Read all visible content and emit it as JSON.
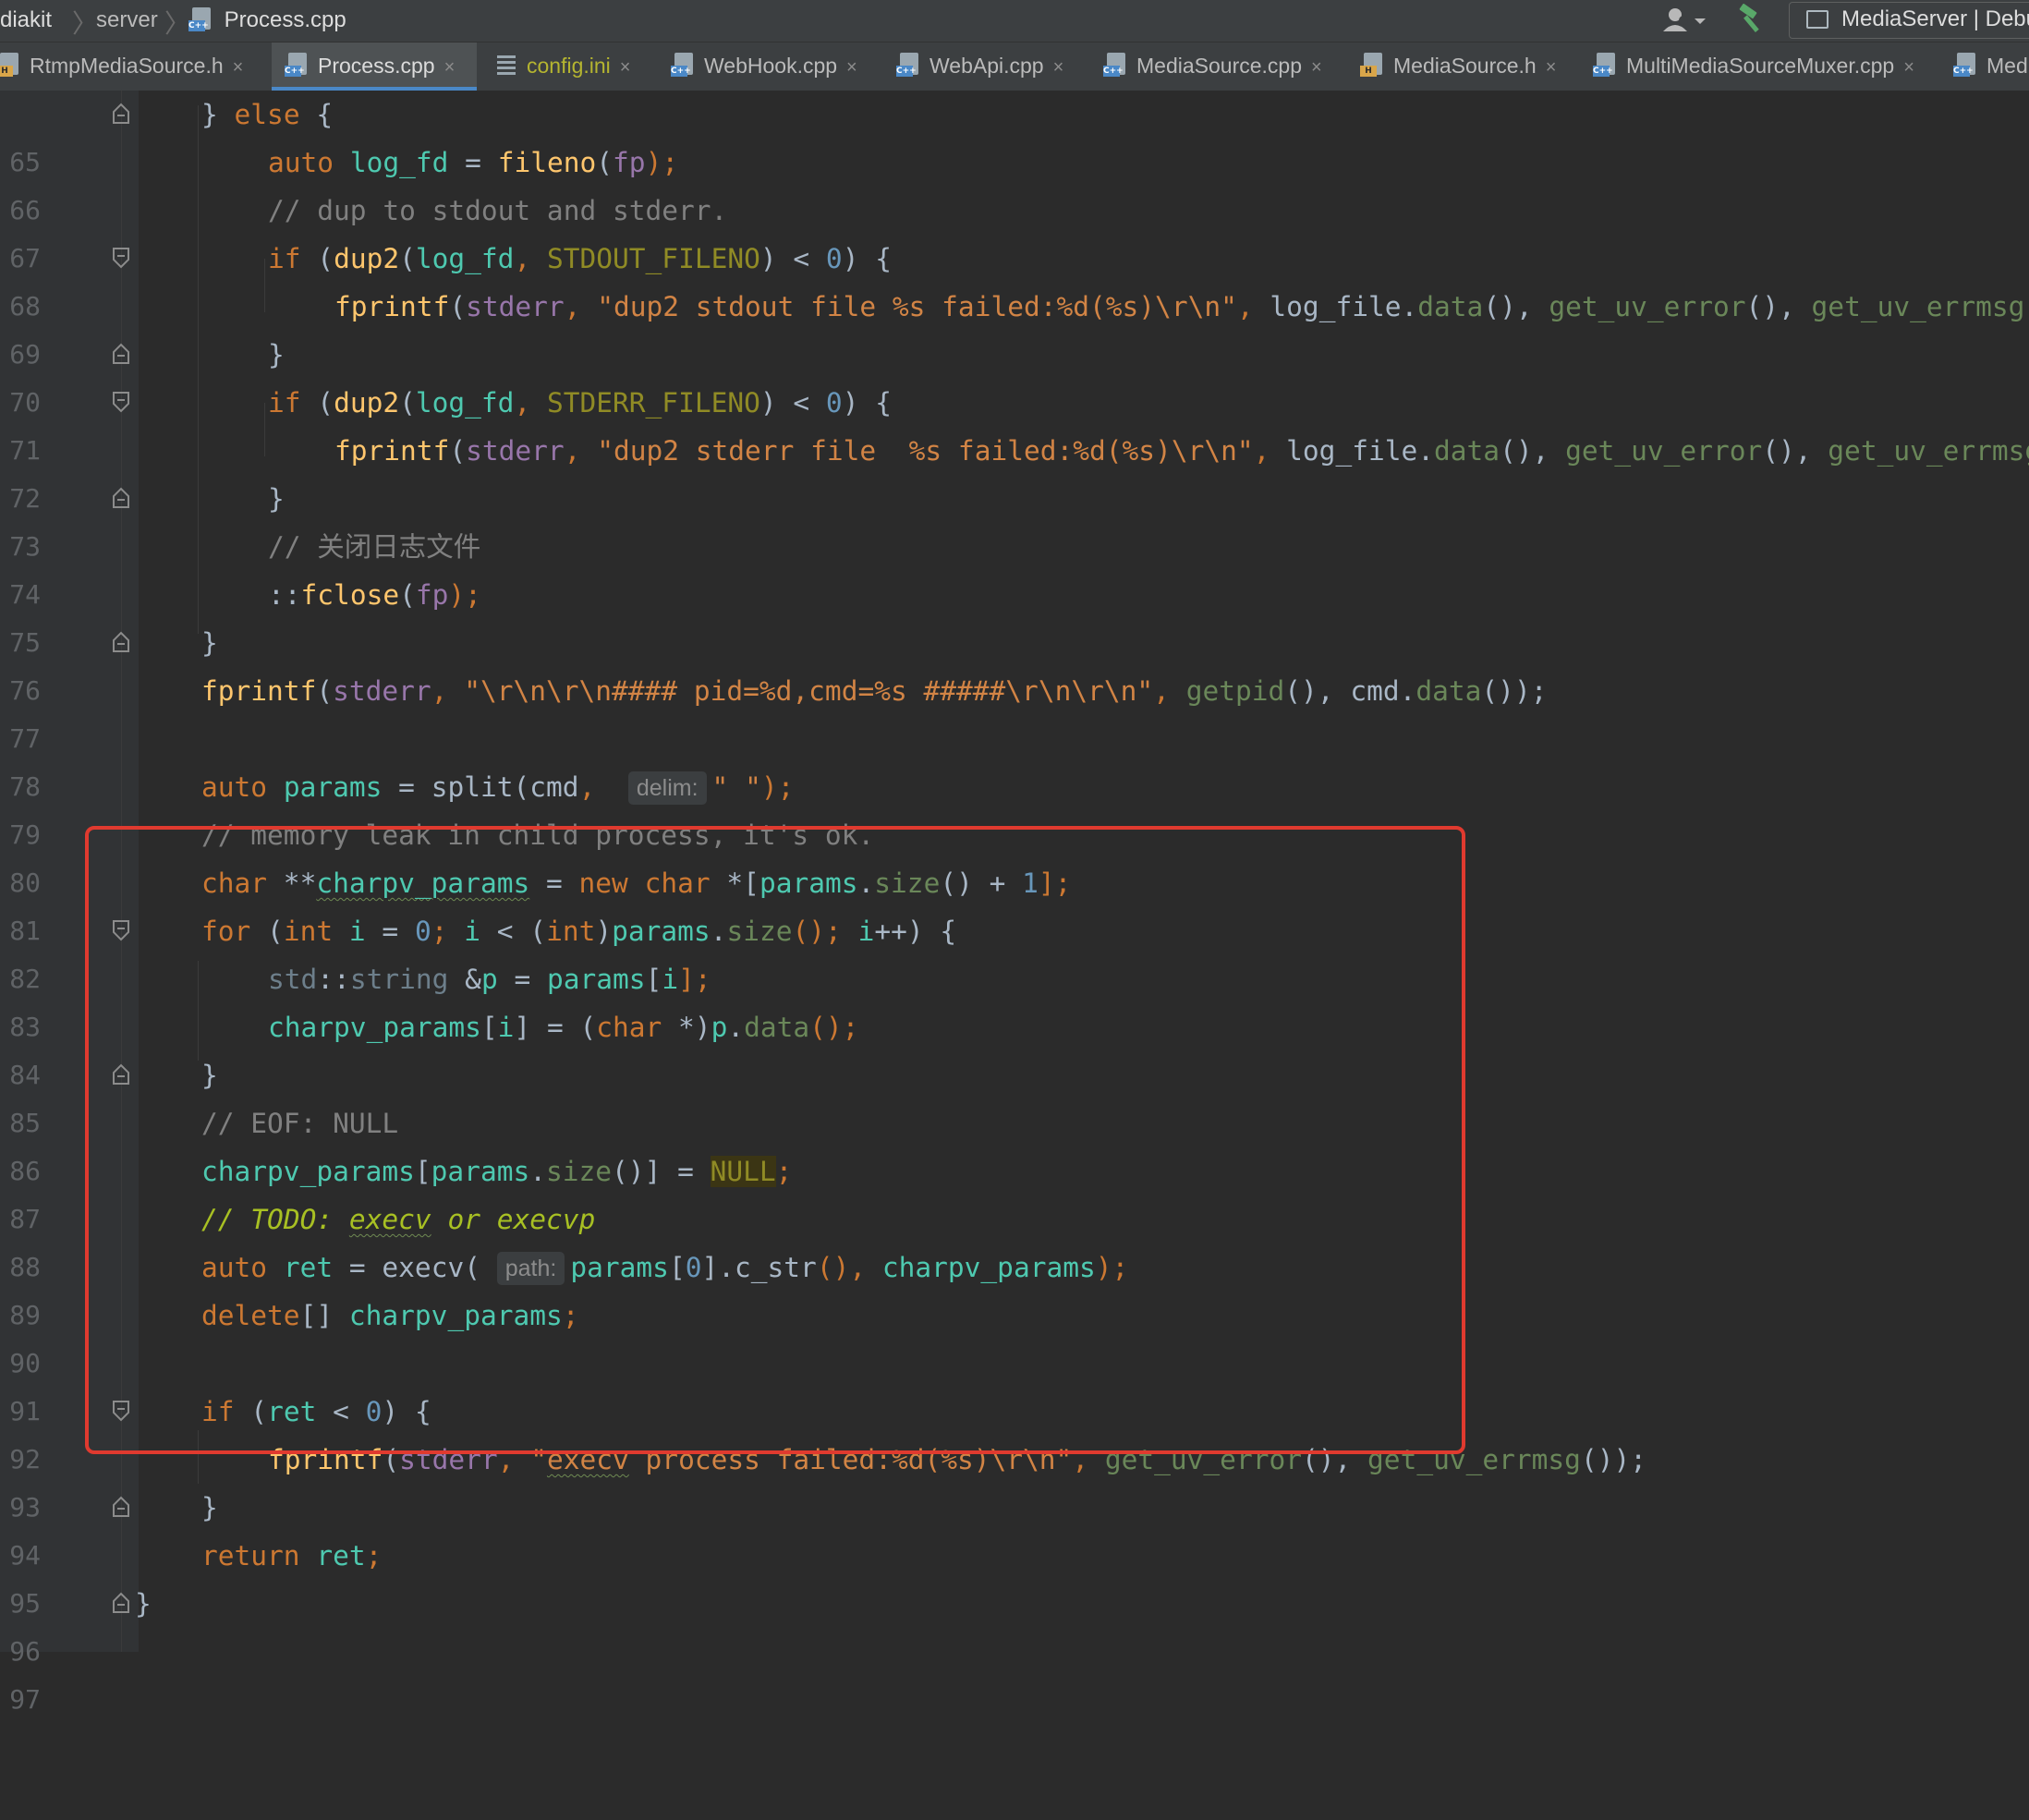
{
  "breadcrumb": {
    "items": [
      "diakit",
      "server",
      "Process.cpp"
    ]
  },
  "run_config": {
    "label": "MediaServer | Debug"
  },
  "tabs": [
    {
      "label": "RtmpMediaSource.h",
      "type": "h",
      "active": false
    },
    {
      "label": "Process.cpp",
      "type": "cpp",
      "active": true
    },
    {
      "label": "config.ini",
      "type": "ini",
      "active": false
    },
    {
      "label": "WebHook.cpp",
      "type": "cpp",
      "active": false
    },
    {
      "label": "WebApi.cpp",
      "type": "cpp",
      "active": false
    },
    {
      "label": "MediaSource.cpp",
      "type": "cpp",
      "active": false
    },
    {
      "label": "MediaSource.h",
      "type": "h",
      "active": false
    },
    {
      "label": "MultiMediaSourceMuxer.cpp",
      "type": "cpp",
      "active": false
    },
    {
      "label": "Med",
      "type": "cpp",
      "active": false
    }
  ],
  "icons": {
    "cpp_tag": "C++",
    "h_tag": "H",
    "close": "×"
  },
  "colors": {
    "highlight_box": "#e03a2f",
    "active_tab_indicator": "#4a88c7",
    "keyword": "#cc7832",
    "string": "#6a8759",
    "comment": "#808080"
  },
  "editor": {
    "line_numbers": [
      "65",
      "66",
      "67",
      "68",
      "69",
      "70",
      "71",
      "72",
      "73",
      "74",
      "75",
      "76",
      "77",
      "78",
      "79",
      "80",
      "81",
      "82",
      "83",
      "84",
      "85",
      "86",
      "87",
      "88",
      "89",
      "90",
      "91",
      "92",
      "93",
      "94",
      "95",
      "96",
      "97"
    ],
    "hints": {
      "delim": "delim:",
      "path": "path:"
    },
    "code": {
      "l65_close": "} ",
      "l65_else": "else",
      "l65_rest": " {",
      "l66_auto": "auto",
      "l66_var": "log_fd",
      "l66_eq": " = ",
      "l66_fn": "fileno",
      "l66_p1": "(",
      "l66_arg": "fp",
      "l66_p2": ");",
      "l67": "// dup to stdout and stderr.",
      "l68_if": "if",
      "l68_a": " (",
      "l68_fn": "dup2",
      "l68_b": "(",
      "l68_v": "log_fd",
      "l68_c": ", ",
      "l68_mac": "STDOUT_FILENO",
      "l68_d": ") < ",
      "l68_num": "0",
      "l68_e": ") {",
      "l69_fn": "fprintf",
      "l69_a": "(",
      "l69_v": "stderr",
      "l69_b": ", ",
      "l69_str": "\"dup2 stdout file %s failed:%d(%s)\\r\\n\"",
      "l69_c": ", ",
      "l69_d": "log_file",
      "l69_e": ".",
      "l69_f": "data",
      "l69_g": "(), ",
      "l69_h": "get_uv_error",
      "l69_i": "(), ",
      "l69_j": "get_uv_errmsg",
      "l70": "}",
      "l71_if": "if",
      "l71_a": " (",
      "l71_fn": "dup2",
      "l71_b": "(",
      "l71_v": "log_fd",
      "l71_c": ", ",
      "l71_mac": "STDERR_FILENO",
      "l71_d": ") < ",
      "l71_num": "0",
      "l71_e": ") {",
      "l72_fn": "fprintf",
      "l72_a": "(",
      "l72_v": "stderr",
      "l72_b": ", ",
      "l72_str": "\"dup2 stderr file  %s failed:%d(%s)\\r\\n\"",
      "l72_c": ", ",
      "l72_d": "log_file",
      "l72_e": ".",
      "l72_f": "data",
      "l72_g": "(), ",
      "l72_h": "get_uv_error",
      "l72_i": "(), ",
      "l72_j": "get_uv_errmsg",
      "l73": "}",
      "l74": "// 关闭日志文件",
      "l75_a": "::",
      "l75_fn": "fclose",
      "l75_b": "(",
      "l75_v": "fp",
      "l75_c": ");",
      "l76": "}",
      "l77_fn": "fprintf",
      "l77_a": "(",
      "l77_v": "stderr",
      "l77_b": ", ",
      "l77_str": "\"\\r\\n\\r\\n#### pid=%d,cmd=%s #####\\r\\n\\r\\n\"",
      "l77_c": ", ",
      "l77_d": "getpid",
      "l77_e": "(), ",
      "l77_f": "cmd",
      "l77_g": ".",
      "l77_h": "data",
      "l77_i": "());",
      "l79_auto": "auto",
      "l79_var": "params",
      "l79_eq": " = ",
      "l79_fn": "split",
      "l79_a": "(",
      "l79_b": "cmd",
      "l79_c": ", ",
      "l79_str": "\" \"",
      "l79_d": ");",
      "l80": "// memory leak in child process, it's ok.",
      "l81_kw": "char",
      "l81_a": " **",
      "l81_var": "charpv_params",
      "l81_b": " = ",
      "l81_new": "new",
      "l81_c": " ",
      "l81_char": "char",
      "l81_d": " *[",
      "l81_e": "params",
      "l81_f": ".",
      "l81_g": "size",
      "l81_h": "() + ",
      "l81_num": "1",
      "l81_i": "];",
      "l82_for": "for",
      "l82_a": " (",
      "l82_int": "int",
      "l82_b": " ",
      "l82_i": "i",
      "l82_c": " = ",
      "l82_num": "0",
      "l82_d": "; ",
      "l82_i2": "i",
      "l82_e": " < (",
      "l82_int2": "int",
      "l82_f": ")",
      "l82_g": "params",
      "l82_h": ".",
      "l82_j": "size",
      "l82_k": "(); ",
      "l82_i3": "i",
      "l82_l": "++) {",
      "l83_ns": "std",
      "l83_a": "::",
      "l83_t": "string",
      "l83_b": " &",
      "l83_p": "p",
      "l83_c": " = ",
      "l83_d": "params",
      "l83_e": "[",
      "l83_i": "i",
      "l83_f": "];",
      "l84_v": "charpv_params",
      "l84_a": "[",
      "l84_i": "i",
      "l84_b": "] = (",
      "l84_char": "char",
      "l84_c": " *)",
      "l84_p": "p",
      "l84_d": ".",
      "l84_fn": "data",
      "l84_e": "();",
      "l85": "}",
      "l86": "// EOF: NULL",
      "l87_v": "charpv_params",
      "l87_a": "[",
      "l87_b": "params",
      "l87_c": ".",
      "l87_d": "size",
      "l87_e": "()] = ",
      "l87_null": "NULL",
      "l87_f": ";",
      "l88_a": "// ",
      "l88_todo": "TODO: ",
      "l88_b": "execv",
      "l88_c": " or ",
      "l88_d": "execvp",
      "l89_auto": "auto",
      "l89_var": "ret",
      "l89_eq": " = ",
      "l89_fn": "execv",
      "l89_a": "(",
      "l89_b": "params",
      "l89_c": "[",
      "l89_num": "0",
      "l89_d": "].",
      "l89_e": "c_str",
      "l89_f": "(), ",
      "l89_g": "charpv_params",
      "l89_h": ");",
      "l90_kw": "delete",
      "l90_a": "[] ",
      "l90_v": "charpv_params",
      "l90_b": ";",
      "l92_if": "if",
      "l92_a": " (",
      "l92_v": "ret",
      "l92_b": " < ",
      "l92_num": "0",
      "l92_c": ") {",
      "l93_fn": "fprintf",
      "l93_a": "(",
      "l93_v": "stderr",
      "l93_b": ", ",
      "l93_s1": "\"",
      "l93_s2": "execv",
      "l93_s3": " process failed:%d(%s)\\r\\n\"",
      "l93_c": ", ",
      "l93_d": "get_uv_error",
      "l93_e": "(), ",
      "l93_f": "get_uv_errmsg",
      "l93_g": "());",
      "l94": "}",
      "l95_kw": "return",
      "l95_a": " ",
      "l95_v": "ret",
      "l95_b": ";",
      "l96": "}"
    }
  }
}
